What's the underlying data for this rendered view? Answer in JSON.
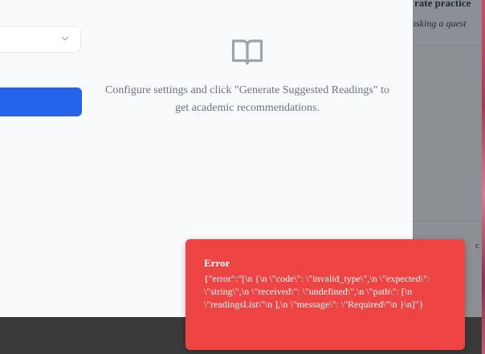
{
  "background_page": {
    "title_fragment": "rate practice",
    "subtitle_fragment": "asking a quest",
    "row_fragment": "c"
  },
  "modal": {
    "select": {
      "value": "",
      "icon": "chevron-down-icon"
    },
    "generate_button": {
      "label": "",
      "icon": "chevron-right-icon",
      "color": "#2563eb"
    },
    "empty_state": {
      "icon": "book-open-icon",
      "message": "Configure settings and click \"Generate Suggested Readings\" to get academic recommendations."
    }
  },
  "toast": {
    "title": "Error",
    "message": "{\"error\":\"[\\n {\\n \\\"code\\\": \\\"invalid_type\\\",\\n \\\"expected\\\": \\\"string\\\",\\n \\\"received\\\": \\\"undefined\\\",\\n \\\"path\\\": [\\n \\\"readingsList\\\"\\n ],\\n \\\"message\\\": \\\"Required\\\"\\n }\\n]\"}",
    "color": "#ef4444"
  }
}
